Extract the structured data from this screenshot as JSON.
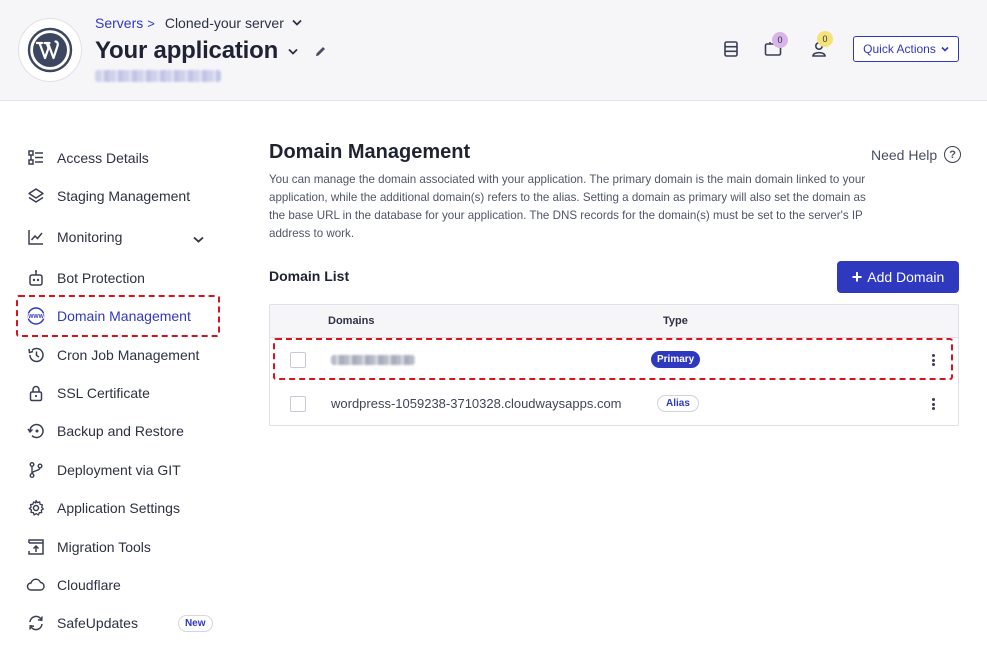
{
  "header": {
    "breadcrumb": {
      "servers": "Servers",
      "separator": ">",
      "server_name": "Cloned-your server"
    },
    "app_title": "Your application",
    "notifications": {
      "projects_count": "0",
      "users_count": "0"
    },
    "quick_actions_label": "Quick Actions",
    "colors": {
      "accent": "#2f39bf",
      "projects_badge": "#d9b3ea",
      "users_badge": "#f6e27a"
    }
  },
  "sidebar": {
    "items": [
      {
        "label": "Access Details",
        "icon": "access-details-icon"
      },
      {
        "label": "Staging Management",
        "icon": "layers-icon"
      },
      {
        "label": "Monitoring",
        "icon": "chart-line-icon"
      },
      {
        "label": "Bot Protection",
        "icon": "robot-icon"
      },
      {
        "label": "Domain Management",
        "icon": "www-globe-icon"
      },
      {
        "label": "Cron Job Management",
        "icon": "clock-history-icon"
      },
      {
        "label": "SSL Certificate",
        "icon": "lock-icon"
      },
      {
        "label": "Backup and Restore",
        "icon": "restore-icon"
      },
      {
        "label": "Deployment via GIT",
        "icon": "git-branch-icon"
      },
      {
        "label": "Application Settings",
        "icon": "gear-icon"
      },
      {
        "label": "Migration Tools",
        "icon": "migration-icon"
      },
      {
        "label": "Cloudflare",
        "icon": "cloud-icon"
      },
      {
        "label": "SafeUpdates",
        "icon": "refresh-icon"
      }
    ],
    "new_badge": "New"
  },
  "main": {
    "title": "Domain Management",
    "need_help": "Need Help",
    "description": "You can manage the domain associated with your application. The primary domain is the main domain linked to your application, while the additional domain(s) refers to the alias. Setting a domain as primary will also set the domain as the base URL in the database for your application. The DNS records for the domain(s) must be set to the server's IP address to work.",
    "domain_list_title": "Domain List",
    "add_domain_label": "Add Domain",
    "table": {
      "columns": [
        "Domains",
        "Type"
      ],
      "rows": [
        {
          "type": "Primary"
        },
        {
          "domain": "wordpress-1059238-3710328.cloudwaysapps.com",
          "type": "Alias"
        }
      ]
    }
  }
}
